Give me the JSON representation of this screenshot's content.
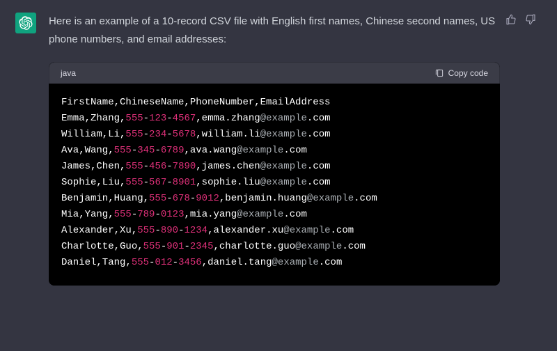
{
  "message": {
    "intro": "Here is an example of a 10-record CSV file with English first names, Chinese second names, US phone numbers, and email addresses:"
  },
  "code": {
    "language": "java",
    "copy_label": "Copy code",
    "header_line": "FirstName,ChineseName,PhoneNumber,EmailAddress",
    "rows": [
      {
        "first": "Emma",
        "last": "Zhang",
        "p1": "555",
        "p2": "123",
        "p3": "4567",
        "eu": "emma.zhang",
        "ed": "example",
        "et": ".com"
      },
      {
        "first": "William",
        "last": "Li",
        "p1": "555",
        "p2": "234",
        "p3": "5678",
        "eu": "william.li",
        "ed": "example",
        "et": ".com"
      },
      {
        "first": "Ava",
        "last": "Wang",
        "p1": "555",
        "p2": "345",
        "p3": "6789",
        "eu": "ava.wang",
        "ed": "example",
        "et": ".com"
      },
      {
        "first": "James",
        "last": "Chen",
        "p1": "555",
        "p2": "456",
        "p3": "7890",
        "eu": "james.chen",
        "ed": "example",
        "et": ".com"
      },
      {
        "first": "Sophie",
        "last": "Liu",
        "p1": "555",
        "p2": "567",
        "p3": "8901",
        "eu": "sophie.liu",
        "ed": "example",
        "et": ".com"
      },
      {
        "first": "Benjamin",
        "last": "Huang",
        "p1": "555",
        "p2": "678",
        "p3": "9012",
        "eu": "benjamin.huang",
        "ed": "example",
        "et": ".com"
      },
      {
        "first": "Mia",
        "last": "Yang",
        "p1": "555",
        "p2": "789",
        "p3": "0123",
        "eu": "mia.yang",
        "ed": "example",
        "et": ".com"
      },
      {
        "first": "Alexander",
        "last": "Xu",
        "p1": "555",
        "p2": "890",
        "p3": "1234",
        "eu": "alexander.xu",
        "ed": "example",
        "et": ".com"
      },
      {
        "first": "Charlotte",
        "last": "Guo",
        "p1": "555",
        "p2": "901",
        "p3": "2345",
        "eu": "charlotte.guo",
        "ed": "example",
        "et": ".com"
      },
      {
        "first": "Daniel",
        "last": "Tang",
        "p1": "555",
        "p2": "012",
        "p3": "3456",
        "eu": "daniel.tang",
        "ed": "example",
        "et": ".com"
      }
    ]
  }
}
